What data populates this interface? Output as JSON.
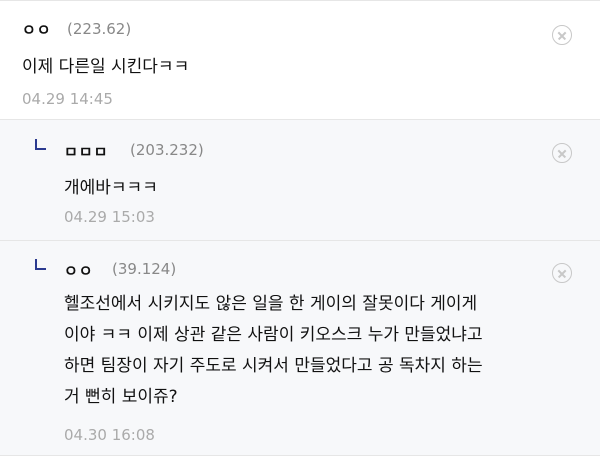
{
  "comments": [
    {
      "author": "ㅇㅇ",
      "ip": "(223.62)",
      "text": "이제 다른일 시킨다ㅋㅋ",
      "time": "04.29 14:45",
      "is_reply": false
    },
    {
      "author": "ㅁㅁㅁ",
      "ip": "(203.232)",
      "text": "개에바ㅋㅋㅋ",
      "time": "04.29 15:03",
      "is_reply": true
    },
    {
      "author": "ㅇㅇ",
      "ip": "(39.124)",
      "text": "헬조선에서 시키지도 않은 일을 한 게이의 잘못이다 게이게\n이야 ㅋㅋ 이제 상관 같은 사람이 키오스크 누가 만들었냐고\n하면 팀장이 자기 주도로 시켜서 만들었다고 공 독차지 하는\n거 뻔히 보이쥬?",
      "time": "04.30 16:08",
      "is_reply": true
    }
  ],
  "icons": {
    "delete": "close-circle-icon",
    "reply": "reply-arrow-icon"
  },
  "colors": {
    "reply_mark": "#2b3a8f",
    "meta": "#aaaaaa",
    "reply_bg": "#f7f8fa"
  }
}
